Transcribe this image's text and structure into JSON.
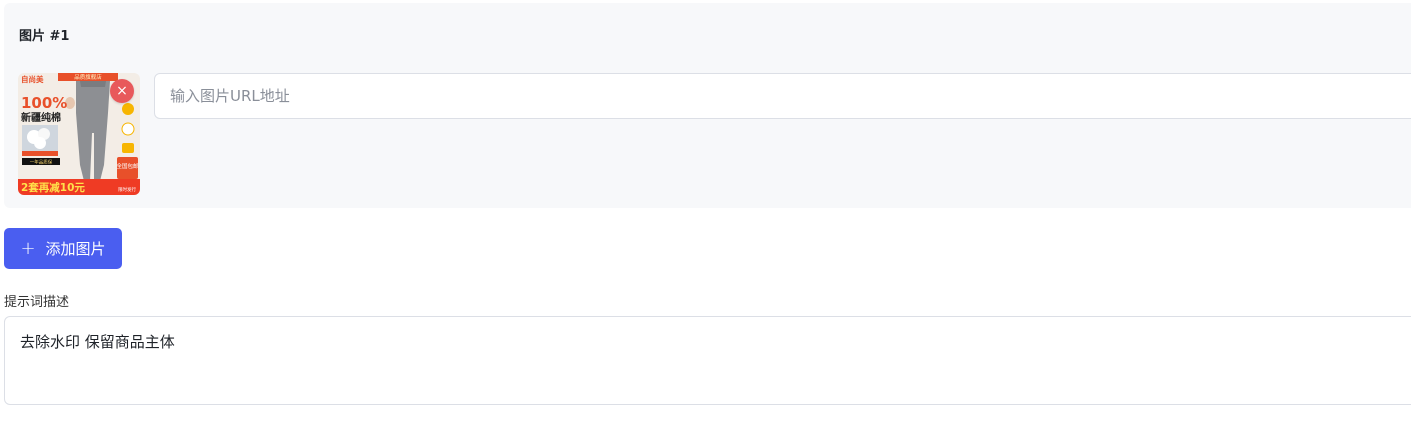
{
  "image_item": {
    "title": "图片 #1",
    "remove_icon": "close-icon",
    "remove_glyph": "×",
    "url_placeholder": "输入图片URL地址",
    "url_value": "",
    "thumbnail": {
      "brand": "自尚美",
      "top_banner": "品质旗舰店",
      "headline_percent": "100%",
      "headline_text": "新疆纯棉",
      "small_tag": "一年品质保",
      "bottom_banner": "2套再减10元",
      "side_badge": "全国包邮",
      "corner_text": "限时发行"
    }
  },
  "add_button": {
    "icon": "plus-icon",
    "icon_glyph": "+",
    "label": "添加图片"
  },
  "prompt": {
    "label": "提示词描述",
    "value": "去除水印 保留商品主体"
  },
  "colors": {
    "primary": "#4a5ef0",
    "remove": "#e8595b",
    "card_bg": "#f7f8fa",
    "border": "#dcdfe6"
  }
}
